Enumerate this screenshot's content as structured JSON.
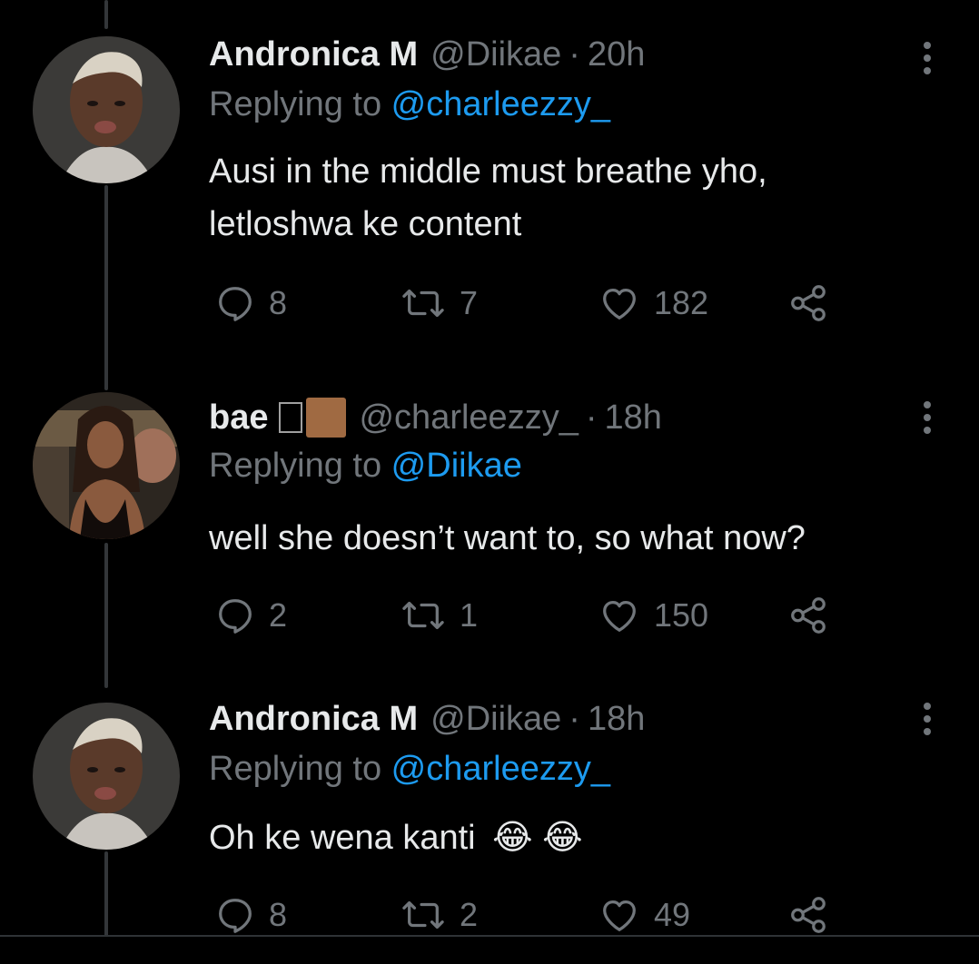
{
  "tweets": [
    {
      "name": "Andronica M",
      "handle": "@Diikae",
      "dot": "·",
      "time": "20h",
      "replying_prefix": "Replying to ",
      "replying_to": "@charleezzy_",
      "text_line1": "Ausi in the middle must breathe yho,",
      "text_line2": "letloshwa ke content",
      "replies": "8",
      "retweets": "7",
      "likes": "182"
    },
    {
      "name": "bae",
      "handle": "@charleezzy_",
      "dot": "·",
      "time": "18h",
      "replying_prefix": "Replying to ",
      "replying_to": "@Diikae",
      "text_line1": "well she doesn’t want to, so what now?",
      "replies": "2",
      "retweets": "1",
      "likes": "150"
    },
    {
      "name": "Andronica M",
      "handle": "@Diikae",
      "dot": "·",
      "time": "18h",
      "replying_prefix": "Replying to ",
      "replying_to": "@charleezzy_",
      "text_line1": "Oh ke wena kanti",
      "emoji": "😂 😂",
      "replies": "8",
      "retweets": "2",
      "likes": "49"
    }
  ],
  "colors": {
    "background": "#000000",
    "primary_text": "#e7e9ea",
    "secondary_text": "#71767b",
    "link": "#1d9bf0",
    "thread_line": "#333639"
  },
  "icons": [
    "reply-icon",
    "retweet-icon",
    "like-icon",
    "share-icon",
    "more-icon"
  ]
}
